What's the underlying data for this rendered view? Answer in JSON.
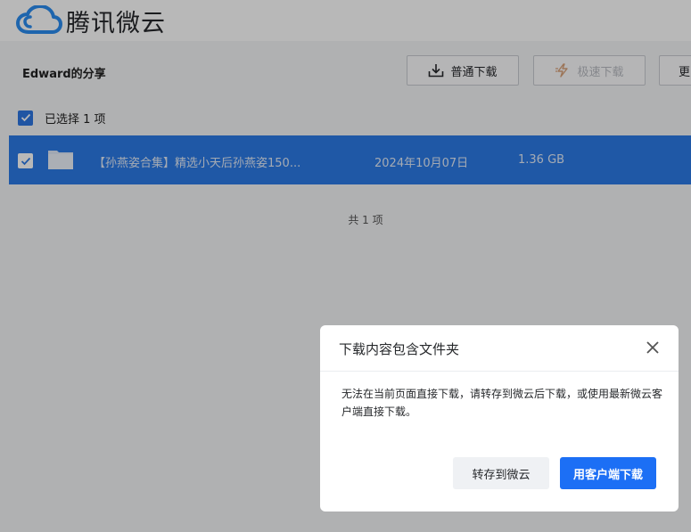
{
  "header": {
    "logo_text": "腾讯微云",
    "logo_icon": "cloud-logo-icon"
  },
  "toolbar": {
    "share_owner": "Edward的分享",
    "normal_download": "普通下载",
    "fast_download": "极速下载",
    "more": "更"
  },
  "selection": {
    "selected_text": "已选择 1 项"
  },
  "files": [
    {
      "name": "【孙燕姿合集】精选小天后孙燕姿150...",
      "date": "2024年10月07日",
      "size": "1.36 GB",
      "type_icon": "folder-icon",
      "selected": true
    }
  ],
  "total_text": "共 1 项",
  "dialog": {
    "title": "下载内容包含文件夹",
    "message": "无法在当前页面直接下载，请转存到微云后下载，或使用最新微云客户端直接下载。",
    "save_button": "转存到微云",
    "client_button": "用客户端下载"
  },
  "colors": {
    "accent": "#1c6ff5",
    "selected_row": "#2c7ae6",
    "checkbox": "#2d76e2"
  }
}
